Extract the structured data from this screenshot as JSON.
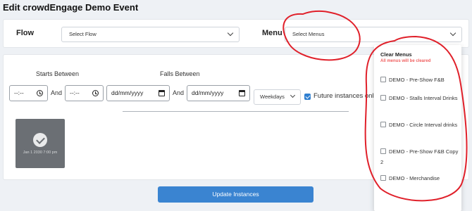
{
  "page": {
    "title": "Edit crowdEngage Demo Event"
  },
  "top_bar": {
    "flow_label": "Flow",
    "flow_select": "Select Flow",
    "menu_label": "Menu",
    "menu_select": "Select Menus"
  },
  "filters": {
    "starts_between": "Starts Between",
    "falls_between": "Falls Between",
    "time_placeholder_1": "--:--",
    "time_placeholder_2": "--:--",
    "and_1": "And",
    "and_2": "And",
    "date_placeholder_1": "dd/mm/yyyy",
    "date_placeholder_2": "dd/mm/yyyy",
    "days_select": "Weekdays",
    "future_only_label": "Future instances onl",
    "future_only_checked": true
  },
  "instance_tile": {
    "date_text": "Jan 1 2030 7:00 pm",
    "selected": true
  },
  "update_button": "Update Instances",
  "menu_dropdown": {
    "title": "Clear Menus",
    "warning": "All menus will be cleared",
    "items": [
      "DEMO - Pre-Show F&B",
      "DEMO - Stalls Interval Drinks",
      "DEMO - Circle Interval drinks",
      "DEMO - Pre-Show F&B Copy 2",
      "DEMO - Merchandise"
    ]
  },
  "colors": {
    "accent": "#3a84d1",
    "warning": "#f06060",
    "annotation": "#e0202a"
  },
  "icons": [
    "chevron-down-icon",
    "clock-icon",
    "calendar-icon",
    "checkmark-icon"
  ]
}
